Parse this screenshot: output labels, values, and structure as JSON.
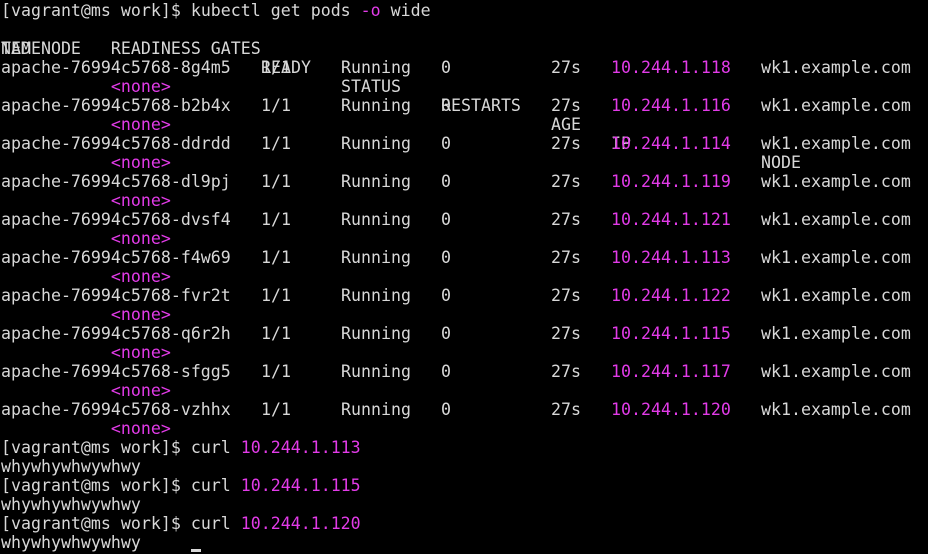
{
  "terminal": {
    "prompt": "[vagrant@ms work]$ ",
    "command1": {
      "pre": "kubectl get pods ",
      "flag": "-o",
      "post": " wide"
    },
    "header": {
      "name": "NAME",
      "ready": "READY",
      "status": "STATUS",
      "restarts": "RESTARTS",
      "age": "AGE",
      "ip": "IP",
      "node": "NODE",
      "wrap": "TED NODE   READINESS GATES"
    },
    "wrap_prefix": "           ",
    "none_label": "<none>",
    "pods": [
      {
        "name": "apache-76994c5768-8g4m5",
        "ready": "1/1",
        "status": "Running",
        "restarts": "0",
        "age": "27s",
        "ip": "10.244.1.118",
        "node": "wk1.example.com"
      },
      {
        "name": "apache-76994c5768-b2b4x",
        "ready": "1/1",
        "status": "Running",
        "restarts": "0",
        "age": "27s",
        "ip": "10.244.1.116",
        "node": "wk1.example.com"
      },
      {
        "name": "apache-76994c5768-ddrdd",
        "ready": "1/1",
        "status": "Running",
        "restarts": "0",
        "age": "27s",
        "ip": "10.244.1.114",
        "node": "wk1.example.com"
      },
      {
        "name": "apache-76994c5768-dl9pj",
        "ready": "1/1",
        "status": "Running",
        "restarts": "0",
        "age": "27s",
        "ip": "10.244.1.119",
        "node": "wk1.example.com"
      },
      {
        "name": "apache-76994c5768-dvsf4",
        "ready": "1/1",
        "status": "Running",
        "restarts": "0",
        "age": "27s",
        "ip": "10.244.1.121",
        "node": "wk1.example.com"
      },
      {
        "name": "apache-76994c5768-f4w69",
        "ready": "1/1",
        "status": "Running",
        "restarts": "0",
        "age": "27s",
        "ip": "10.244.1.113",
        "node": "wk1.example.com"
      },
      {
        "name": "apache-76994c5768-fvr2t",
        "ready": "1/1",
        "status": "Running",
        "restarts": "0",
        "age": "27s",
        "ip": "10.244.1.122",
        "node": "wk1.example.com"
      },
      {
        "name": "apache-76994c5768-q6r2h",
        "ready": "1/1",
        "status": "Running",
        "restarts": "0",
        "age": "27s",
        "ip": "10.244.1.115",
        "node": "wk1.example.com"
      },
      {
        "name": "apache-76994c5768-sfgg5",
        "ready": "1/1",
        "status": "Running",
        "restarts": "0",
        "age": "27s",
        "ip": "10.244.1.117",
        "node": "wk1.example.com"
      },
      {
        "name": "apache-76994c5768-vzhhx",
        "ready": "1/1",
        "status": "Running",
        "restarts": "0",
        "age": "27s",
        "ip": "10.244.1.120",
        "node": "wk1.example.com"
      }
    ],
    "curls": [
      {
        "cmd": "curl ",
        "ip": "10.244.1.113",
        "output": "whywhywhwywhwy"
      },
      {
        "cmd": "curl ",
        "ip": "10.244.1.115",
        "output": "whywhywhwywhwy"
      },
      {
        "cmd": "curl ",
        "ip": "10.244.1.120",
        "output": "whywhywhwywhwy"
      }
    ],
    "colors": {
      "background": "#000000",
      "text": "#d8d8d8",
      "highlight": "#e23be8"
    }
  }
}
